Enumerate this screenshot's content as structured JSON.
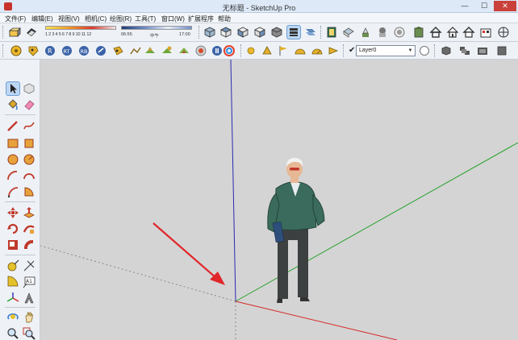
{
  "window": {
    "title": "无标题 - SketchUp Pro",
    "app_icon": "sketchup-logo-icon",
    "controls": {
      "minimize": "—",
      "maximize": "☐",
      "close": "✕"
    }
  },
  "menu": [
    {
      "label": "文件(F)"
    },
    {
      "label": "编辑(E)"
    },
    {
      "label": "视图(V)"
    },
    {
      "label": "相机(C)"
    },
    {
      "label": "绘图(R)"
    },
    {
      "label": "工具(T)"
    },
    {
      "label": "窗口(W)"
    },
    {
      "label": "扩展程序"
    },
    {
      "label": "帮助"
    }
  ],
  "shadow_settings": {
    "month_labels": "1 2 3 4 5 6 7 8 9 10 11 12",
    "time_labels": {
      "start": "06:55",
      "mid": "中午",
      "end": "17:00"
    }
  },
  "layer": {
    "current": "Layer0",
    "checked": true,
    "check_glyph": "✔",
    "dropdown_arrow": "▼"
  },
  "toolbar_icons": {
    "row1": [
      "shadow-toggle-icon",
      "fog-toggle-icon",
      "shadow-month-slider",
      "shadow-time-slider",
      "iso-view-icon",
      "top-view-icon",
      "front-view-icon",
      "right-view-icon",
      "back-view-icon",
      "left-view-icon",
      "xray-icon",
      "back-edges-icon",
      "wireframe-icon",
      "hidden-line-icon",
      "shaded-icon",
      "shaded-textures-icon",
      "monochrome-icon",
      "section-plane-icon",
      "house-icon",
      "warehouse-icon",
      "extension-warehouse-icon",
      "share-model-icon",
      "photo-texture-icon",
      "nav-icon"
    ],
    "row2": [
      "sandbox-icon",
      "dimension-icon",
      "round-corner-icon",
      "bezier-icon",
      "solid-tools-icon",
      "location-icon",
      "smoove-icon",
      "stamp-icon",
      "drape-icon",
      "flip-edge-icon",
      "add-detail-icon",
      "ruby-console-icon",
      "color-wheel-icon",
      "sun-icon",
      "dimension-text-icon",
      "flag-icon",
      "arc-label-icon",
      "protractor-label-icon",
      "layer-manager-icon",
      "component-icon",
      "outliner-icon",
      "styles-icon"
    ]
  },
  "left_tools": [
    "select-arrow-icon",
    "component-box-icon",
    "paint-bucket-icon",
    "eraser-icon",
    "line-pencil-icon",
    "freehand-icon",
    "rectangle-icon",
    "rotated-rectangle-icon",
    "circle-icon",
    "polygon-icon",
    "arc-icon",
    "two-point-arc-icon",
    "three-point-arc-icon",
    "pie-icon",
    "move-icon",
    "push-pull-icon",
    "rotate-icon",
    "follow-me-icon",
    "scale-icon",
    "offset-icon",
    "tape-measure-icon",
    "dimension-icon",
    "protractor-icon",
    "text-icon",
    "axes-icon",
    "3d-text-icon",
    "orbit-icon",
    "pan-icon",
    "zoom-icon",
    "zoom-window-icon"
  ],
  "scene": {
    "background": "#d4d4d4",
    "axis_colors": {
      "red": "#d62828",
      "green": "#27a12b",
      "blue": "#2a2ab0",
      "dotted": "#8a8a8a"
    },
    "annotation_arrow_color": "#e0262a",
    "figure": "scale-figure-person-icon"
  }
}
